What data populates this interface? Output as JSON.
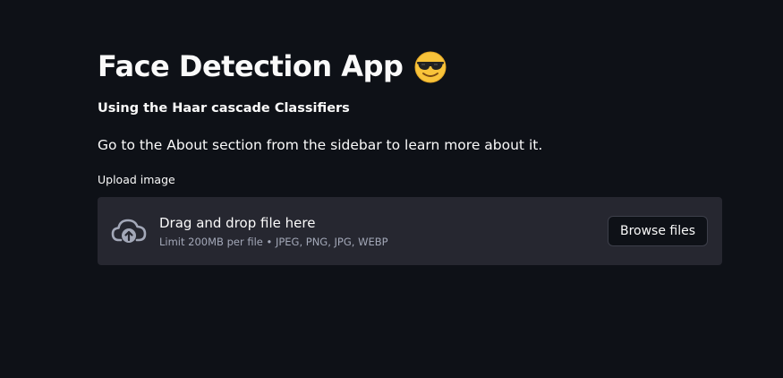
{
  "header": {
    "title": "Face Detection App",
    "title_icon": "smiling-face-with-sunglasses-icon"
  },
  "subtitle": "Using the Haar cascade Classifiers",
  "description": "Go to the About section from the sidebar to learn more about it.",
  "uploader": {
    "label": "Upload image",
    "dropzone_title": "Drag and drop file here",
    "limit_text": "Limit 200MB per file • JPEG, PNG, JPG, WEBP",
    "icon": "cloud-upload-icon",
    "browse_label": "Browse files"
  },
  "colors": {
    "background": "#0e1117",
    "dropzone": "#262730",
    "text": "#fafafa",
    "muted_text": "#a3a8b8",
    "emoji_yellow": "#f8c33a"
  }
}
